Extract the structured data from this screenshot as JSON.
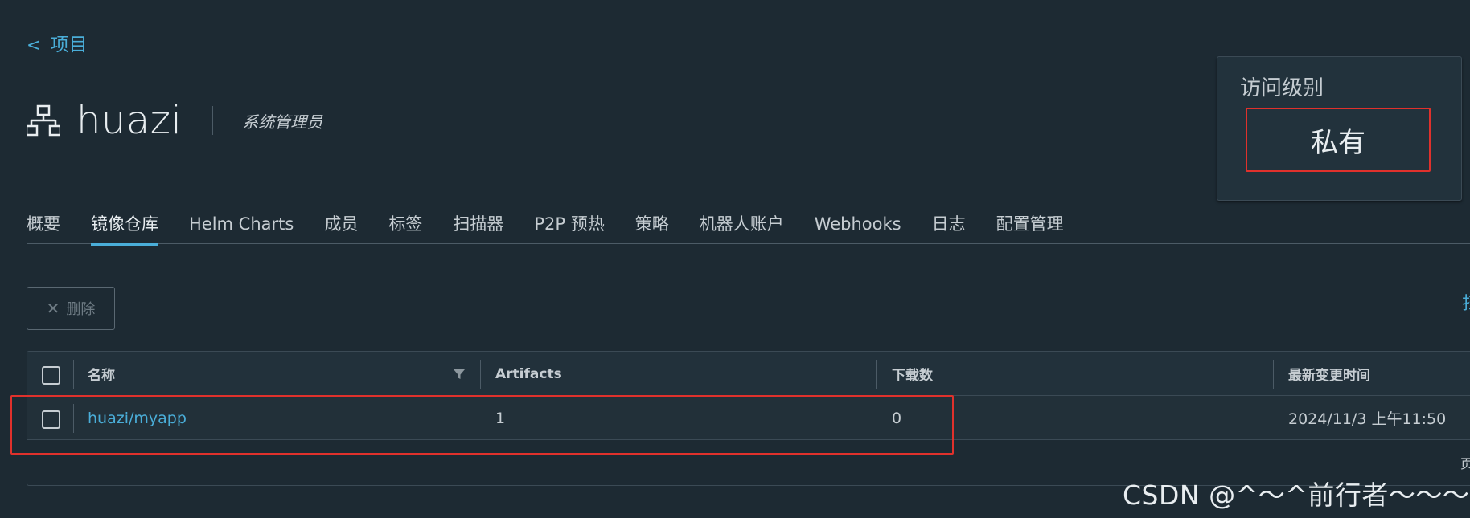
{
  "nav": {
    "back_chevron": "<",
    "back_label": "项目"
  },
  "project": {
    "icon": "project-tree-icon",
    "name": "huazi",
    "role": "系统管理员"
  },
  "access": {
    "label": "访问级别",
    "value": "私有"
  },
  "tabs": [
    {
      "label": "概要",
      "active": false
    },
    {
      "label": "镜像仓库",
      "active": true
    },
    {
      "label": "Helm Charts",
      "active": false
    },
    {
      "label": "成员",
      "active": false
    },
    {
      "label": "标签",
      "active": false
    },
    {
      "label": "扫描器",
      "active": false
    },
    {
      "label": "P2P 预热",
      "active": false
    },
    {
      "label": "策略",
      "active": false
    },
    {
      "label": "机器人账户",
      "active": false
    },
    {
      "label": "Webhooks",
      "active": false
    },
    {
      "label": "日志",
      "active": false
    },
    {
      "label": "配置管理",
      "active": false
    }
  ],
  "toolbar": {
    "delete_label": "删除",
    "delete_icon": "close-icon",
    "right_edge_char": "扫"
  },
  "table": {
    "columns": [
      "名称",
      "Artifacts",
      "下载数",
      "最新变更时间"
    ],
    "rows": [
      {
        "name": "huazi/myapp",
        "artifacts": "1",
        "downloads": "0",
        "updated": "2024/11/3 上午11:50"
      }
    ],
    "footer_char": "页"
  },
  "watermark": "CSDN @^～^前行者～～～",
  "colors": {
    "accent": "#4aaed9",
    "background": "#1d2a33",
    "highlight": "#e0312c"
  }
}
